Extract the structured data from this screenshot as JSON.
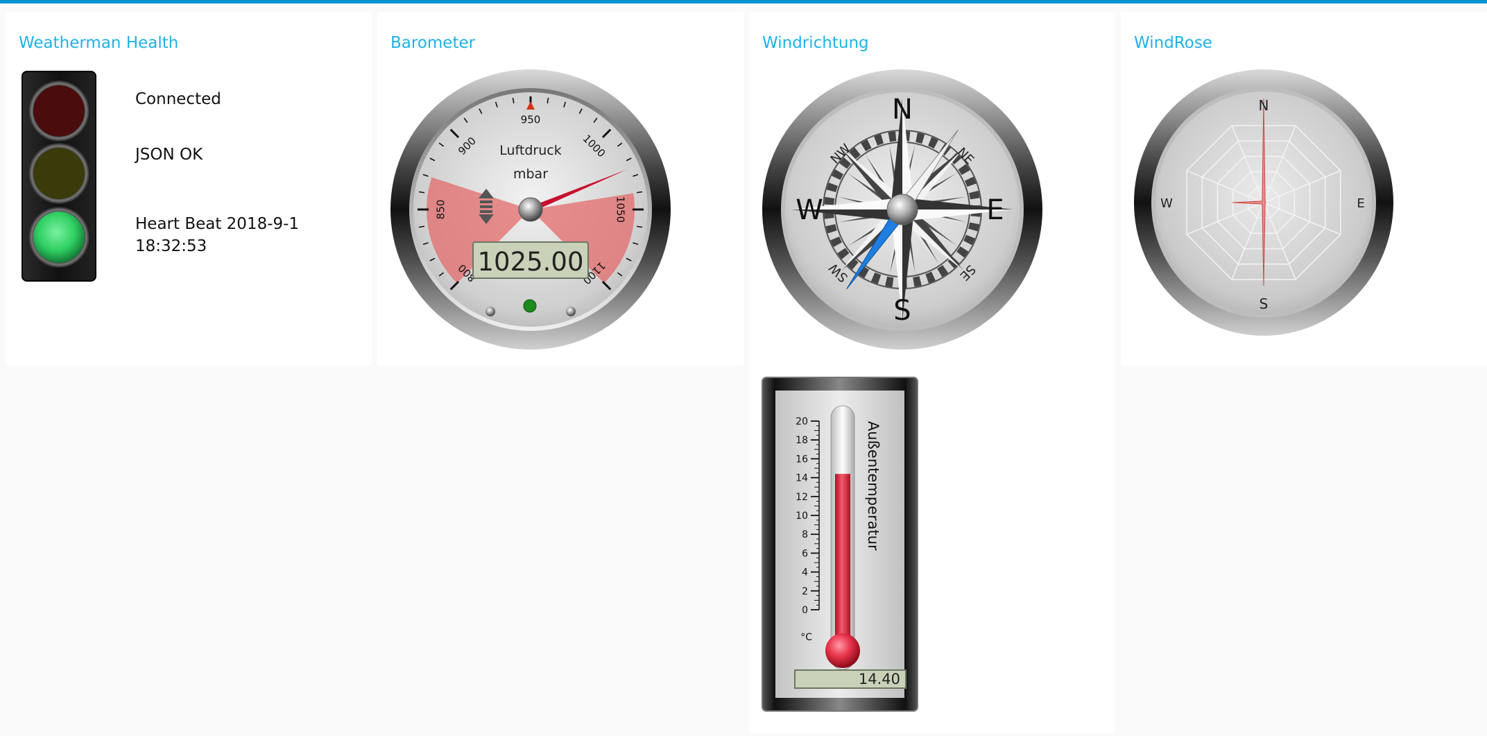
{
  "colors": {
    "accent": "#0094ce",
    "title": "#1fb2e8",
    "tlight_red_off": "#4a0c0c",
    "tlight_yellow_off": "#3a3a0a",
    "tlight_green_on": "#2fcf63",
    "danger_zone": "#e36b6b",
    "needle_red": "#c8102e",
    "compass_blue": "#1e7fe0",
    "thermo_red": "#e8334a"
  },
  "health": {
    "title": "Weatherman Health",
    "traffic_light_state": "green",
    "line1": "Connected",
    "line2": "JSON OK",
    "line3": "Heart Beat 2018-9-1",
    "line4": "18:32:53"
  },
  "barometer": {
    "title": "Barometer",
    "label_top": "Luftdruck",
    "label_unit": "mbar",
    "value": 1025.0,
    "value_text": "1025.00",
    "scale_min": 800,
    "scale_max": 1100,
    "scale_labels": [
      "800",
      "850",
      "900",
      "950",
      "1000",
      "1050",
      "1100"
    ],
    "trend_icon": "up-down-arrow-icon",
    "status_led": "green"
  },
  "wind_direction": {
    "title": "Windrichtung",
    "heading_deg": 35,
    "cardinals": [
      "N",
      "E",
      "S",
      "W"
    ],
    "intercardinals": [
      "NE",
      "SE",
      "SW",
      "NW"
    ]
  },
  "wind_rose": {
    "title": "WindRose",
    "cardinals": [
      "N",
      "E",
      "S",
      "W"
    ],
    "sectors": [
      1.0,
      0.0,
      0.0,
      0.0,
      0.8,
      0.0,
      0.3,
      0.0
    ]
  },
  "thermometer": {
    "label": "Außentemperatur",
    "unit": "°C",
    "value": 14.4,
    "value_text": "14.40",
    "scale_min": 0,
    "scale_max": 20,
    "scale_labels": [
      "0",
      "2",
      "4",
      "6",
      "8",
      "10",
      "12",
      "14",
      "16",
      "18",
      "20"
    ]
  }
}
